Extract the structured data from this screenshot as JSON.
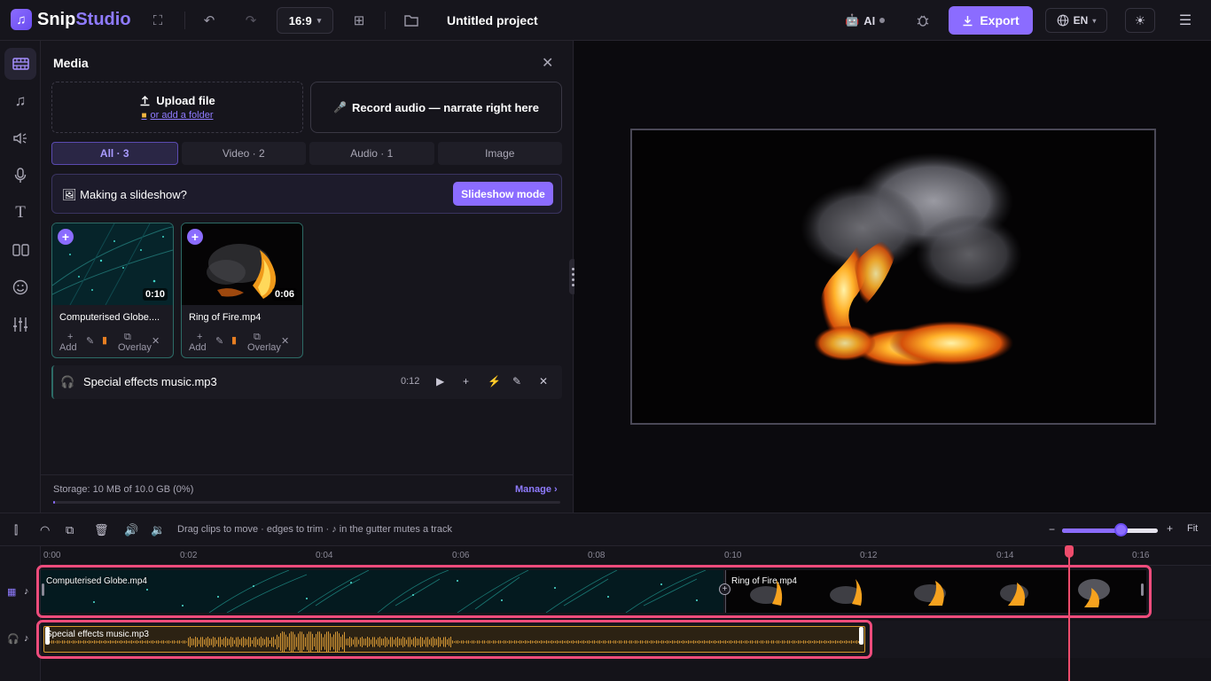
{
  "app": {
    "logo_prefix": "Snip",
    "logo_suffix": "Studio",
    "aspect_ratio": "16:9",
    "project_title": "Untitled project",
    "ai_label": "AI",
    "export_label": "Export",
    "language": "EN",
    "accent_color": "#8b6cff"
  },
  "media": {
    "title": "Media",
    "upload_label": "Upload file",
    "upload_sub": "or add a folder",
    "record_label": "Record audio — narrate right here",
    "tabs": [
      "All · 3",
      "Video · 2",
      "Audio · 1",
      "Image"
    ],
    "active_tab": 0,
    "slideshow_text": "Making a slideshow?",
    "slideshow_button": "Slideshow mode",
    "cards": [
      {
        "name": "Computerised Globe....",
        "duration": "0:10",
        "add": "Add",
        "overlay": "Overlay"
      },
      {
        "name": "Ring of Fire.mp4",
        "duration": "0:06",
        "add": "Add",
        "overlay": "Overlay"
      }
    ],
    "audio": {
      "name": "Special effects music.mp3",
      "duration": "0:12"
    },
    "storage_text": "Storage: 10 MB of 10.0 GB (0%)",
    "manage_label": "Manage ›",
    "storage_fraction": 0.001
  },
  "timeline": {
    "hint": "Drag clips to move · edges to trim · ♪ in the gutter mutes a track",
    "fit_label": "Fit",
    "zoom_fraction": 0.6,
    "ruler": [
      "0:00",
      "0:02",
      "0:04",
      "0:06",
      "0:08",
      "0:10",
      "0:12",
      "0:14",
      "0:16"
    ],
    "video_clips": [
      "Computerised Globe.mp4",
      "Ring of Fire.mp4"
    ],
    "audio_clip": "Special effects music.mp3",
    "playhead_time": "0:15"
  }
}
